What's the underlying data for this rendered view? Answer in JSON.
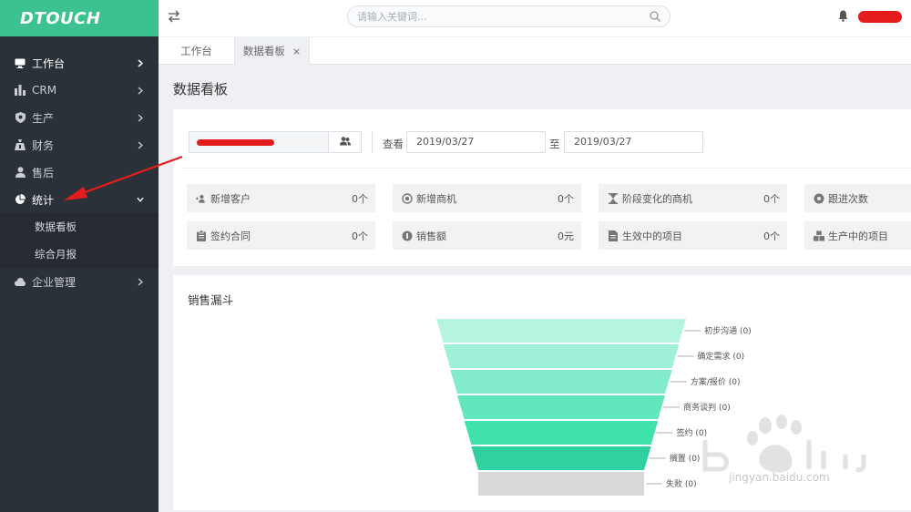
{
  "app": {
    "logo_text": "DTOUCH"
  },
  "topbar": {
    "search_placeholder": "请输入关键词..."
  },
  "sidebar": {
    "items": [
      {
        "label": "工作台",
        "icon": "monitor-icon"
      },
      {
        "label": "CRM",
        "icon": "bar-chart-icon"
      },
      {
        "label": "生产",
        "icon": "shield-icon"
      },
      {
        "label": "财务",
        "icon": "money-bag-icon"
      },
      {
        "label": "售后",
        "icon": "user-icon"
      },
      {
        "label": "统计",
        "icon": "pie-chart-icon"
      }
    ],
    "sub_items": [
      {
        "label": "数据看板"
      },
      {
        "label": "综合月报"
      }
    ],
    "last_item": {
      "label": "企业管理",
      "icon": "cloud-icon"
    }
  },
  "tabs": [
    {
      "label": "工作台"
    },
    {
      "label": "数据看板",
      "close": "×"
    }
  ],
  "page": {
    "title": "数据看板"
  },
  "filter": {
    "view_label": "查看",
    "date_from": "2019/03/27",
    "to_label": "至",
    "date_to": "2019/03/27"
  },
  "stats": [
    {
      "label": "新增客户",
      "value": "0个",
      "icon": "add-customer-icon"
    },
    {
      "label": "新增商机",
      "value": "0个",
      "icon": "target-icon"
    },
    {
      "label": "阶段变化的商机",
      "value": "0个",
      "icon": "hourglass-icon"
    },
    {
      "label": "跟进次数",
      "value": "",
      "icon": "circle-dot-icon"
    },
    {
      "label": "签约合同",
      "value": "0个",
      "icon": "clipboard-icon"
    },
    {
      "label": "销售额",
      "value": "0元",
      "icon": "coin-icon"
    },
    {
      "label": "生效中的项目",
      "value": "0个",
      "icon": "document-icon"
    },
    {
      "label": "生产中的项目",
      "value": "",
      "icon": "cubes-icon"
    }
  ],
  "funnel": {
    "title": "销售漏斗",
    "stages": [
      {
        "name": "初步沟通",
        "value": 0,
        "value_text": "(0)",
        "color": "#b4f4e1"
      },
      {
        "name": "确定需求",
        "value": 0,
        "value_text": "(0)",
        "color": "#9ef0d8"
      },
      {
        "name": "方案/报价",
        "value": 0,
        "value_text": "(0)",
        "color": "#82ebcb"
      },
      {
        "name": "商务谈判",
        "value": 0,
        "value_text": "(0)",
        "color": "#62e6bd"
      },
      {
        "name": "签约",
        "value": 0,
        "value_text": "(0)",
        "color": "#3fe1ad"
      },
      {
        "name": "搁置",
        "value": 0,
        "value_text": "(0)",
        "color": "#2fd1a0"
      },
      {
        "name": "失败",
        "value": 0,
        "value_text": "(0)",
        "color": "#d9d9d9"
      }
    ]
  },
  "watermark": {
    "text": "jingyan.baidu.com"
  },
  "colors": {
    "brand": "#3cc28f",
    "sidebar_bg": "#2b3138",
    "annotation": "#e41c1c"
  }
}
